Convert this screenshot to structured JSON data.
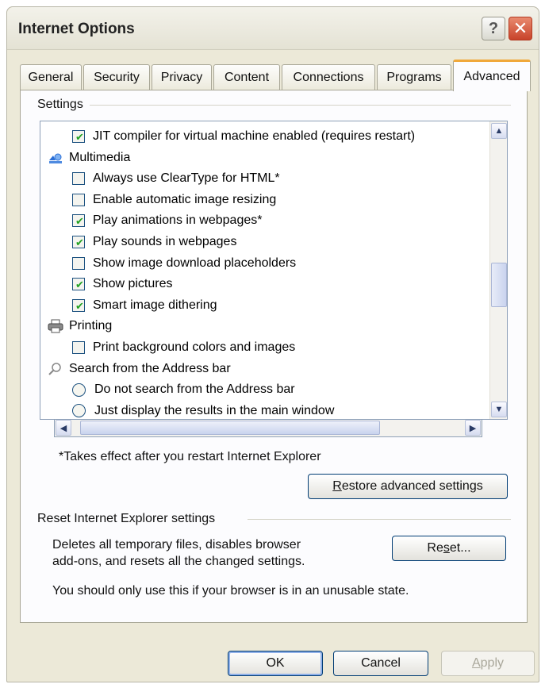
{
  "window": {
    "title": "Internet Options"
  },
  "title_buttons": {
    "help": "?",
    "close": "✕"
  },
  "tabs": [
    {
      "label": "General"
    },
    {
      "label": "Security"
    },
    {
      "label": "Privacy"
    },
    {
      "label": "Content"
    },
    {
      "label": "Connections"
    },
    {
      "label": "Programs"
    },
    {
      "label": "Advanced"
    }
  ],
  "active_tab": "Advanced",
  "settings": {
    "group_label": "Settings",
    "items": [
      {
        "type": "checkbox",
        "checked": true,
        "label": "JIT compiler for virtual machine enabled (requires restart)"
      },
      {
        "type": "category",
        "icon": "multimedia-icon",
        "label": "Multimedia"
      },
      {
        "type": "checkbox",
        "checked": false,
        "label": "Always use ClearType for HTML*"
      },
      {
        "type": "checkbox",
        "checked": false,
        "label": "Enable automatic image resizing"
      },
      {
        "type": "checkbox",
        "checked": true,
        "label": "Play animations in webpages*"
      },
      {
        "type": "checkbox",
        "checked": true,
        "label": "Play sounds in webpages"
      },
      {
        "type": "checkbox",
        "checked": false,
        "label": "Show image download placeholders"
      },
      {
        "type": "checkbox",
        "checked": true,
        "label": "Show pictures"
      },
      {
        "type": "checkbox",
        "checked": true,
        "label": "Smart image dithering"
      },
      {
        "type": "category",
        "icon": "printer-icon",
        "label": "Printing"
      },
      {
        "type": "checkbox",
        "checked": false,
        "label": "Print background colors and images"
      },
      {
        "type": "category",
        "icon": "magnifier-icon",
        "label": "Search from the Address bar"
      },
      {
        "type": "radio",
        "checked": false,
        "label": "Do not search from the Address bar"
      },
      {
        "type": "radio",
        "checked": false,
        "label": "Just display the results in the main window"
      }
    ],
    "footnote": "*Takes effect after you restart Internet Explorer",
    "restore_button": {
      "pre": "",
      "accel": "R",
      "post": "estore advanced settings"
    }
  },
  "reset": {
    "group_label": "Reset Internet Explorer settings",
    "description_line1": "Deletes all temporary files, disables browser",
    "description_line2": "add-ons, and resets all the changed settings.",
    "warning": "You should only use this if your browser is in an unusable state.",
    "reset_button": {
      "pre": "Re",
      "accel": "s",
      "post": "et..."
    }
  },
  "footer": {
    "ok": "OK",
    "cancel": "Cancel",
    "apply": {
      "pre": "",
      "accel": "A",
      "post": "pply"
    }
  }
}
